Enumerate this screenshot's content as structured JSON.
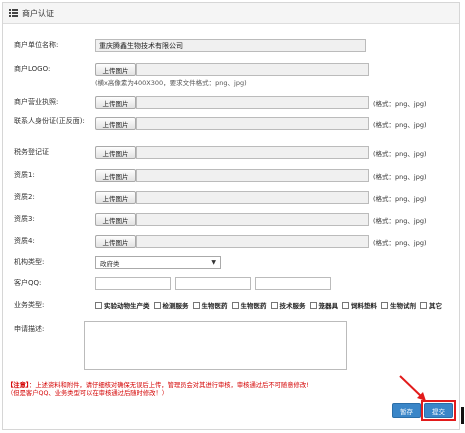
{
  "header": {
    "title": "商户认证",
    "icon": "list-icon"
  },
  "fields": {
    "company_name": {
      "label": "商户单位名称:",
      "value": "重庆腾鑫生物技术有限公司"
    },
    "logo": {
      "label": "商户LOGO:",
      "button": "上传图片",
      "hint": "(横x高像素为400X300，要求文件格式：png、jpg)"
    },
    "license": {
      "label": "商户营业执照:",
      "button": "上传图片",
      "format": "(格式：png、jpg)"
    },
    "id_card": {
      "label": "联系人身份证(正反面):",
      "button": "上传图片",
      "format": "(格式：png、jpg)"
    },
    "tax": {
      "label": "税务登记证",
      "button": "上传图片",
      "format": "(格式：png、jpg)"
    },
    "qual1": {
      "label": "资质1:",
      "button": "上传图片",
      "format": "(格式：png、jpg)"
    },
    "qual2": {
      "label": "资质2:",
      "button": "上传图片",
      "format": "(格式：png、jpg)"
    },
    "qual3": {
      "label": "资质3:",
      "button": "上传图片",
      "format": "(格式：png、jpg)"
    },
    "qual4": {
      "label": "资质4:",
      "button": "上传图片",
      "format": "(格式：png、jpg)"
    },
    "org_type": {
      "label": "机构类型:",
      "selected": "政府类"
    },
    "qq": {
      "label": "客户QQ:"
    },
    "business": {
      "label": "业务类型:",
      "options": [
        "实验动物生产类",
        "检测服务",
        "生物医药",
        "生物医药",
        "技术服务",
        "笼器具",
        "饲料垫料",
        "生物试剂",
        "其它"
      ]
    },
    "description": {
      "label": "申请描述:"
    }
  },
  "notice": {
    "line1_tag": "【注意】",
    "line1": "：上述资料和附件，请仔细核对确保无误后上传，管理员会对其进行审核，审核通过后不可随意修改!",
    "line2": "（但是客户QQ、业务类型可以在审核通过后随时修改！）"
  },
  "actions": {
    "save_label": "暂存",
    "submit_label": "提交"
  },
  "colors": {
    "button_blue": "#3a86c8",
    "highlight_red": "#e21b1b",
    "notice_red": "#d40000"
  }
}
